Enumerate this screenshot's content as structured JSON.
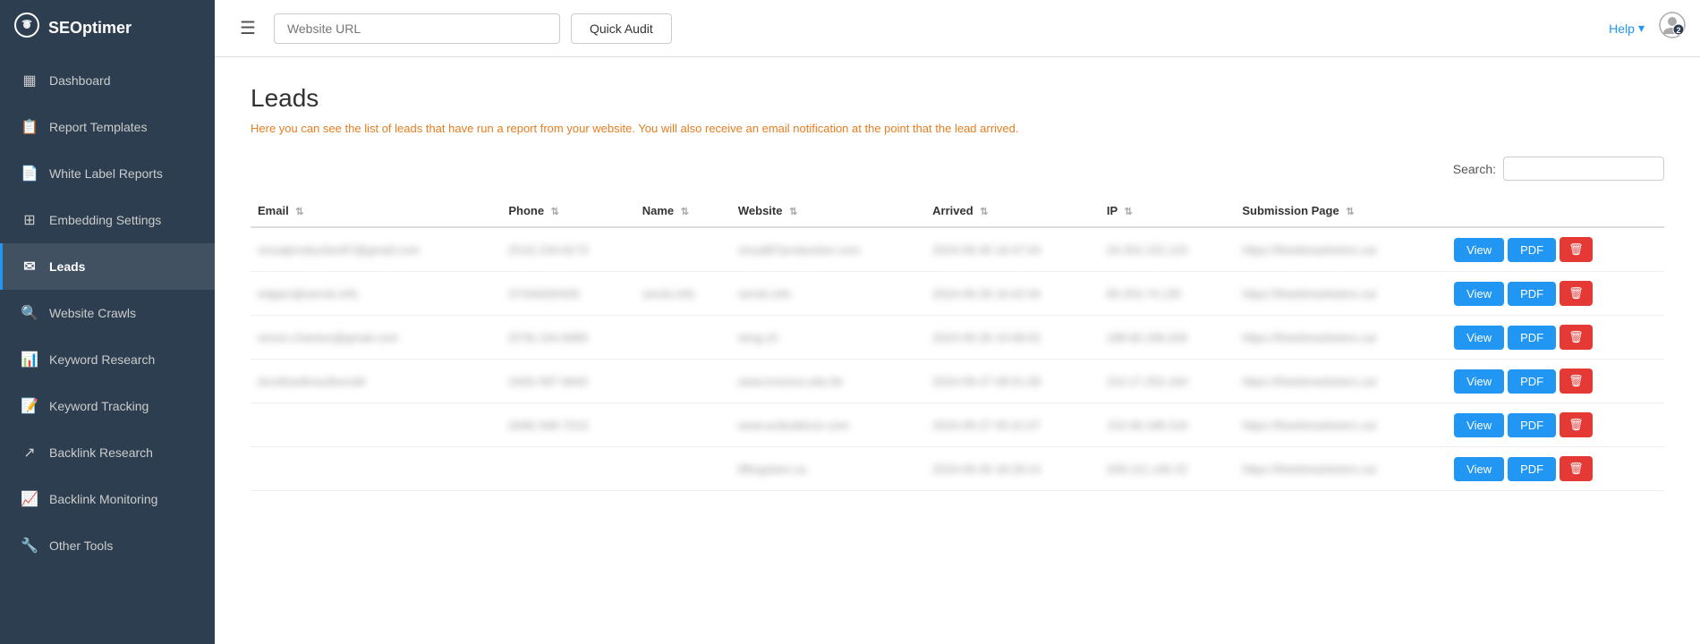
{
  "header": {
    "logo_text": "SEOptimer",
    "url_placeholder": "Website URL",
    "quick_audit_label": "Quick Audit",
    "help_label": "Help",
    "help_arrow": "▾"
  },
  "sidebar": {
    "items": [
      {
        "id": "dashboard",
        "label": "Dashboard",
        "icon": "▦",
        "active": false
      },
      {
        "id": "report-templates",
        "label": "Report Templates",
        "icon": "✎",
        "active": false
      },
      {
        "id": "white-label-reports",
        "label": "White Label Reports",
        "icon": "☰",
        "active": false
      },
      {
        "id": "embedding-settings",
        "label": "Embedding Settings",
        "icon": "▭",
        "active": false
      },
      {
        "id": "leads",
        "label": "Leads",
        "icon": "✉",
        "active": true
      },
      {
        "id": "website-crawls",
        "label": "Website Crawls",
        "icon": "⚲",
        "active": false
      },
      {
        "id": "keyword-research",
        "label": "Keyword Research",
        "icon": "📊",
        "active": false
      },
      {
        "id": "keyword-tracking",
        "label": "Keyword Tracking",
        "icon": "✎",
        "active": false
      },
      {
        "id": "backlink-research",
        "label": "Backlink Research",
        "icon": "↗",
        "active": false
      },
      {
        "id": "backlink-monitoring",
        "label": "Backlink Monitoring",
        "icon": "📈",
        "active": false
      },
      {
        "id": "other-tools",
        "label": "Other Tools",
        "icon": "🔧",
        "active": false
      }
    ]
  },
  "content": {
    "page_title": "Leads",
    "page_desc": "Here you can see the list of leads that have run a report from your website. You will also receive an email notification at the point that the lead arrived.",
    "search_label": "Search:",
    "table": {
      "columns": [
        {
          "id": "email",
          "label": "Email"
        },
        {
          "id": "phone",
          "label": "Phone"
        },
        {
          "id": "name",
          "label": "Name"
        },
        {
          "id": "website",
          "label": "Website"
        },
        {
          "id": "arrived",
          "label": "Arrived"
        },
        {
          "id": "ip",
          "label": "IP"
        },
        {
          "id": "submission_page",
          "label": "Submission Page"
        },
        {
          "id": "actions",
          "label": ""
        }
      ],
      "rows": [
        {
          "email": "visualproduction87@gmail.com",
          "phone": "(514) 234-8173",
          "name": "",
          "website": "visual87production.com",
          "arrived": "2024-09-30 16:47:04",
          "ip": "24.202.152.123",
          "submission_page": "https://theebmarketers.ca/"
        },
        {
          "email": "edgars@serols.info",
          "phone": "07434630435",
          "name": "serols.info",
          "website": "serols.info",
          "arrived": "2024-09-29 16:42:34",
          "ip": "85.254.74.135",
          "submission_page": "https://theebmarketers.ca/"
        },
        {
          "email": "simon.chanton@gmail.com",
          "phone": "(579) 194-6680",
          "name": "",
          "website": "wmg.ch",
          "arrived": "2024-09-29 15:08:02",
          "ip": "188.60.189.200",
          "submission_page": "https://theebmarketers.ca/"
        },
        {
          "email": "dncdinedinsudivovdir",
          "phone": "(340) 587-6942",
          "name": "",
          "website": "www.invictus.edu.hk",
          "arrived": "2024-09-27 08:51:28",
          "ip": "210.17.252.164",
          "submission_page": "https://theebmarketers.ca/"
        },
        {
          "email": "",
          "phone": "(948) 948-7013",
          "name": "",
          "website": "www.acibuildcon.com",
          "arrived": "2024-09-27 05:41:07",
          "ip": "152.58.198.219",
          "submission_page": "https://theebmarketers.ca/"
        },
        {
          "email": "",
          "phone": "",
          "name": "",
          "website": "liftingstars.ca",
          "arrived": "2024-09-26 18:29:14",
          "ip": "209.121.140.22",
          "submission_page": "https://theebmarketers.ca/"
        }
      ]
    }
  },
  "buttons": {
    "view_label": "View",
    "pdf_label": "PDF",
    "delete_icon": "🗑"
  }
}
